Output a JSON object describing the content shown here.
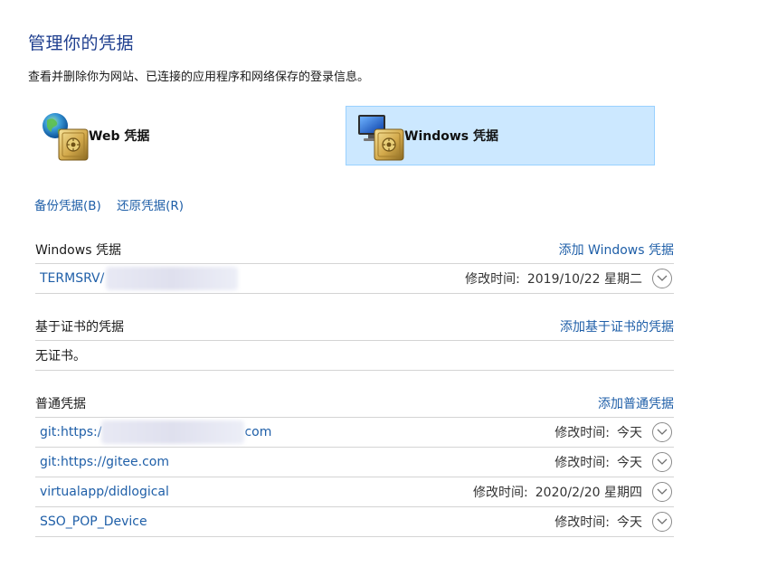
{
  "header": {
    "title": "管理你的凭据",
    "subtitle": "查看并删除你为网站、已连接的应用程序和网络保存的登录信息。"
  },
  "tiles": {
    "web": {
      "label": "Web 凭据",
      "selected": false
    },
    "windows": {
      "label": "Windows 凭据",
      "selected": true
    }
  },
  "links": {
    "backup": "备份凭据(B)",
    "restore": "还原凭据(R)"
  },
  "sections": {
    "windows": {
      "title": "Windows 凭据",
      "add": "添加 Windows 凭据",
      "items": [
        {
          "name": "TERMSRV/",
          "label": "修改时间:",
          "date": "2019/10/22 星期二"
        }
      ]
    },
    "cert": {
      "title": "基于证书的凭据",
      "add": "添加基于证书的凭据",
      "empty": "无证书。"
    },
    "generic": {
      "title": "普通凭据",
      "add": "添加普通凭据",
      "items": [
        {
          "name_prefix": "git:https:/",
          "name_suffix": "com",
          "label": "修改时间:",
          "date": "今天"
        },
        {
          "name": "git:https://gitee.com",
          "label": "修改时间:",
          "date": "今天"
        },
        {
          "name": "virtualapp/didlogical",
          "label": "修改时间:",
          "date": "2020/2/20 星期四"
        },
        {
          "name": "SSO_POP_Device",
          "label": "修改时间:",
          "date": "今天"
        }
      ]
    }
  },
  "colors": {
    "link": "#1f5fa8",
    "title": "#1f3f8f",
    "selected_tile_bg": "#cce8ff",
    "selected_tile_border": "#99d1ff"
  },
  "icons": {
    "web_tile": "globe-vault-icon",
    "windows_tile": "monitor-vault-icon",
    "row_expand": "chevron-down-icon"
  }
}
